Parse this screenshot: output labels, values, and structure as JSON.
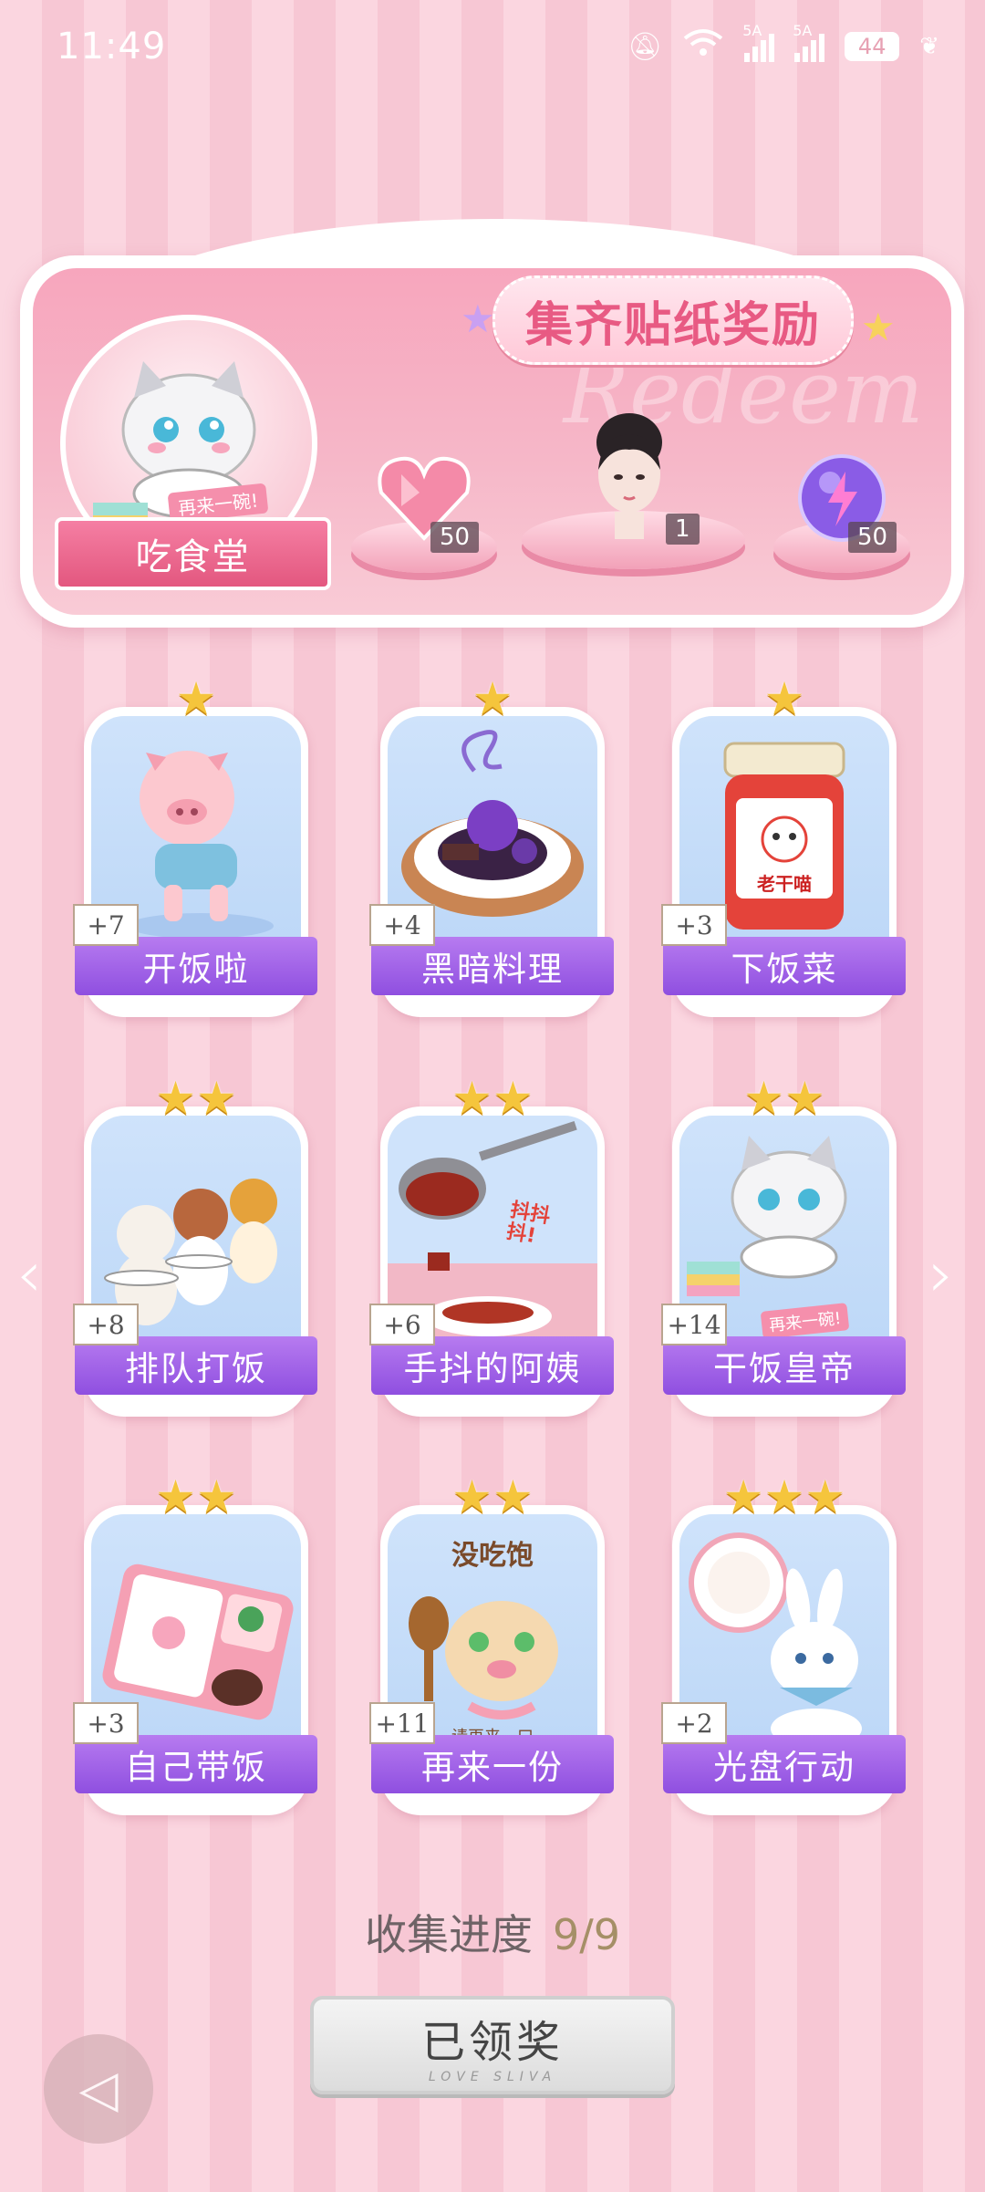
{
  "status_bar": {
    "time": "11:49",
    "net1": "5A",
    "net2": "5A",
    "battery": "44"
  },
  "banner": {
    "title": "集齐贴纸奖励",
    "watermark": "Redeem",
    "tag_text": "再来一碗!",
    "label": "吃食堂",
    "rewards": [
      {
        "icon": "heart-gem-icon",
        "count": "50"
      },
      {
        "icon": "character-portrait",
        "count": "1"
      },
      {
        "icon": "purple-orb-icon",
        "count": "50"
      }
    ]
  },
  "cards": [
    {
      "name": "开饭啦",
      "count": "+7",
      "stars": 1,
      "icon": "running-pig"
    },
    {
      "name": "黑暗料理",
      "count": "+4",
      "stars": 1,
      "icon": "dark-dish"
    },
    {
      "name": "下饭菜",
      "count": "+3",
      "stars": 1,
      "icon": "chili-jar",
      "jar_text": "老干喵"
    },
    {
      "name": "排队打饭",
      "count": "+8",
      "stars": 2,
      "icon": "queue-animals"
    },
    {
      "name": "手抖的阿姨",
      "count": "+6",
      "stars": 2,
      "icon": "ladle-pour",
      "art_text": "抖抖抖!"
    },
    {
      "name": "干饭皇帝",
      "count": "+14",
      "stars": 2,
      "icon": "cat-eating",
      "art_text": "再来一碗!"
    },
    {
      "name": "自己带饭",
      "count": "+3",
      "stars": 2,
      "icon": "lunch-box"
    },
    {
      "name": "再来一份",
      "count": "+11",
      "stars": 2,
      "icon": "hamster-spoon",
      "art_text": "没吃饱",
      "art_text2": "请再来一口"
    },
    {
      "name": "光盘行动",
      "count": "+2",
      "stars": 3,
      "icon": "bunny-plate"
    }
  ],
  "progress": {
    "label": "收集进度",
    "value": "9/9"
  },
  "claim_button": {
    "label": "已领奖",
    "sub": "LOVE SLIVA"
  },
  "colors": {
    "accent": "#8f4fe0",
    "pink": "#f7a6bd",
    "star": "#f5c53c"
  }
}
